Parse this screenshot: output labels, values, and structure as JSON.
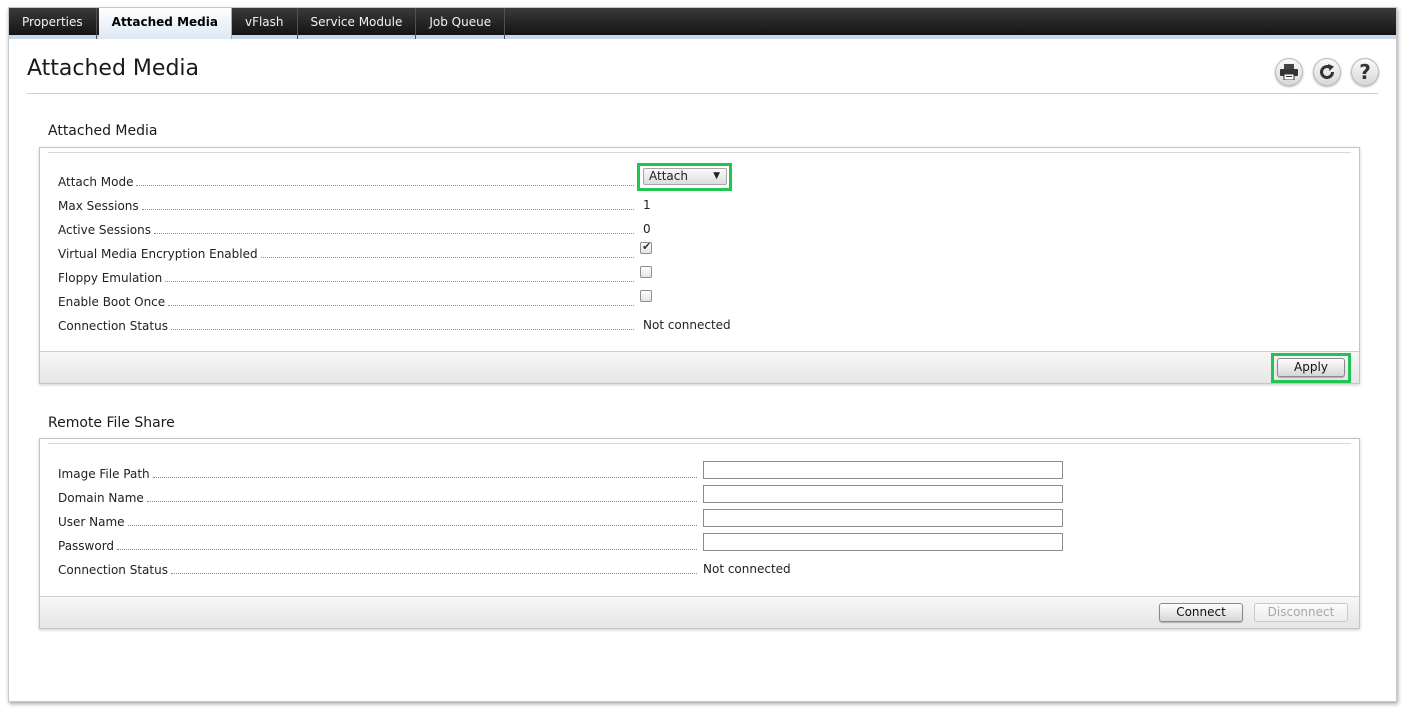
{
  "tabs": [
    {
      "label": "Properties"
    },
    {
      "label": "Attached Media",
      "active": true
    },
    {
      "label": "vFlash"
    },
    {
      "label": "Service Module"
    },
    {
      "label": "Job Queue"
    }
  ],
  "page": {
    "title": "Attached Media"
  },
  "toolbar": {
    "print_icon": "print-icon",
    "refresh_icon": "refresh-icon",
    "help_icon": "help-icon"
  },
  "attached_media": {
    "section_title": "Attached Media",
    "attach_mode": {
      "label": "Attach Mode",
      "selected": "Attach"
    },
    "max_sessions": {
      "label": "Max Sessions",
      "value": "1"
    },
    "active_sessions": {
      "label": "Active Sessions",
      "value": "0"
    },
    "encryption": {
      "label": "Virtual Media Encryption Enabled",
      "checked": true
    },
    "floppy": {
      "label": "Floppy Emulation",
      "checked": false
    },
    "boot_once": {
      "label": "Enable Boot Once",
      "checked": false
    },
    "connection_status": {
      "label": "Connection Status",
      "value": "Not connected"
    },
    "apply_label": "Apply"
  },
  "remote_share": {
    "section_title": "Remote File Share",
    "image_path": {
      "label": "Image File Path",
      "value": ""
    },
    "domain": {
      "label": "Domain Name",
      "value": ""
    },
    "user": {
      "label": "User Name",
      "value": ""
    },
    "password": {
      "label": "Password",
      "value": ""
    },
    "connection_status": {
      "label": "Connection Status",
      "value": "Not connected"
    },
    "connect_label": "Connect",
    "disconnect_label": "Disconnect"
  },
  "colors": {
    "highlight": "#23c552",
    "tabbar": "#1e1e1e",
    "active_tab": "#dde8f4"
  }
}
